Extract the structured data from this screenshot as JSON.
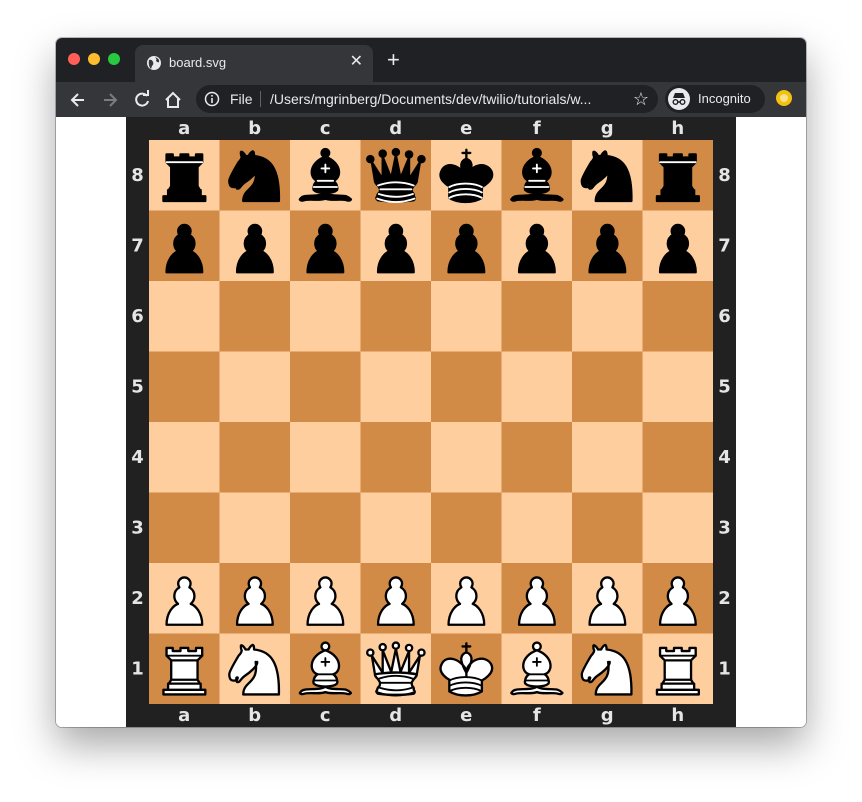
{
  "browser": {
    "tab": {
      "title": "board.svg",
      "close_icon": "close-icon",
      "site_icon": "globe-icon"
    },
    "new_tab_label": "+",
    "address_bar": {
      "scheme_label": "File",
      "url": "/Users/mgrinberg/Documents/dev/twilio/tutorials/w..."
    },
    "profile": {
      "label": "Incognito"
    }
  },
  "board": {
    "colors": {
      "frame": "#212121",
      "light_square": "#ffce9e",
      "dark_square": "#d18b47",
      "coord_text": "#e5e5e5"
    },
    "files": [
      "a",
      "b",
      "c",
      "d",
      "e",
      "f",
      "g",
      "h"
    ],
    "ranks": [
      "8",
      "7",
      "6",
      "5",
      "4",
      "3",
      "2",
      "1"
    ],
    "position": [
      [
        "r",
        "n",
        "b",
        "q",
        "k",
        "b",
        "n",
        "r"
      ],
      [
        "p",
        "p",
        "p",
        "p",
        "p",
        "p",
        "p",
        "p"
      ],
      [
        "",
        "",
        "",
        "",
        "",
        "",
        "",
        ""
      ],
      [
        "",
        "",
        "",
        "",
        "",
        "",
        "",
        ""
      ],
      [
        "",
        "",
        "",
        "",
        "",
        "",
        "",
        ""
      ],
      [
        "",
        "",
        "",
        "",
        "",
        "",
        "",
        ""
      ],
      [
        "P",
        "P",
        "P",
        "P",
        "P",
        "P",
        "P",
        "P"
      ],
      [
        "R",
        "N",
        "B",
        "Q",
        "K",
        "B",
        "N",
        "R"
      ]
    ]
  }
}
